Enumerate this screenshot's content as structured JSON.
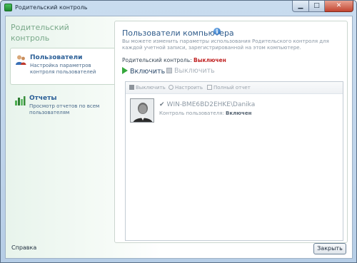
{
  "window": {
    "title": "Родительский контроль"
  },
  "sidebar": {
    "brand": "Родительский контроль",
    "items": [
      {
        "title": "Пользователи",
        "description": "Настройка параметров контроля пользователей",
        "active": true,
        "icon": "users-icon"
      },
      {
        "title": "Отчеты",
        "description": "Просмотр отчетов по всем пользователям",
        "active": false,
        "icon": "reports-chart-icon"
      }
    ],
    "help_label": "Справка"
  },
  "main": {
    "title": "Пользователи компьютера",
    "description": "Вы можете изменить параметры использования Родительского контроля для каждой учетной записи, зарегистрированной на этом компьютере.",
    "status_label": "Родительский контроль:",
    "status_value": "Выключен",
    "enable_label": "Включить",
    "disable_label": "Выключить",
    "list_toolbar": {
      "disable_label": "Выключить",
      "configure_label": "Настроить",
      "report_label": "Полный отчет"
    },
    "users": [
      {
        "name": "WIN-BME6BD2EHKE\\Danika",
        "control_label": "Контроль пользователя:",
        "control_value": "Включен"
      }
    ]
  },
  "footer": {
    "close_label": "Закрыть"
  },
  "colors": {
    "status_off": "#c02222",
    "accent_green": "#36a83c",
    "title_blue": "#2f5b8a"
  }
}
